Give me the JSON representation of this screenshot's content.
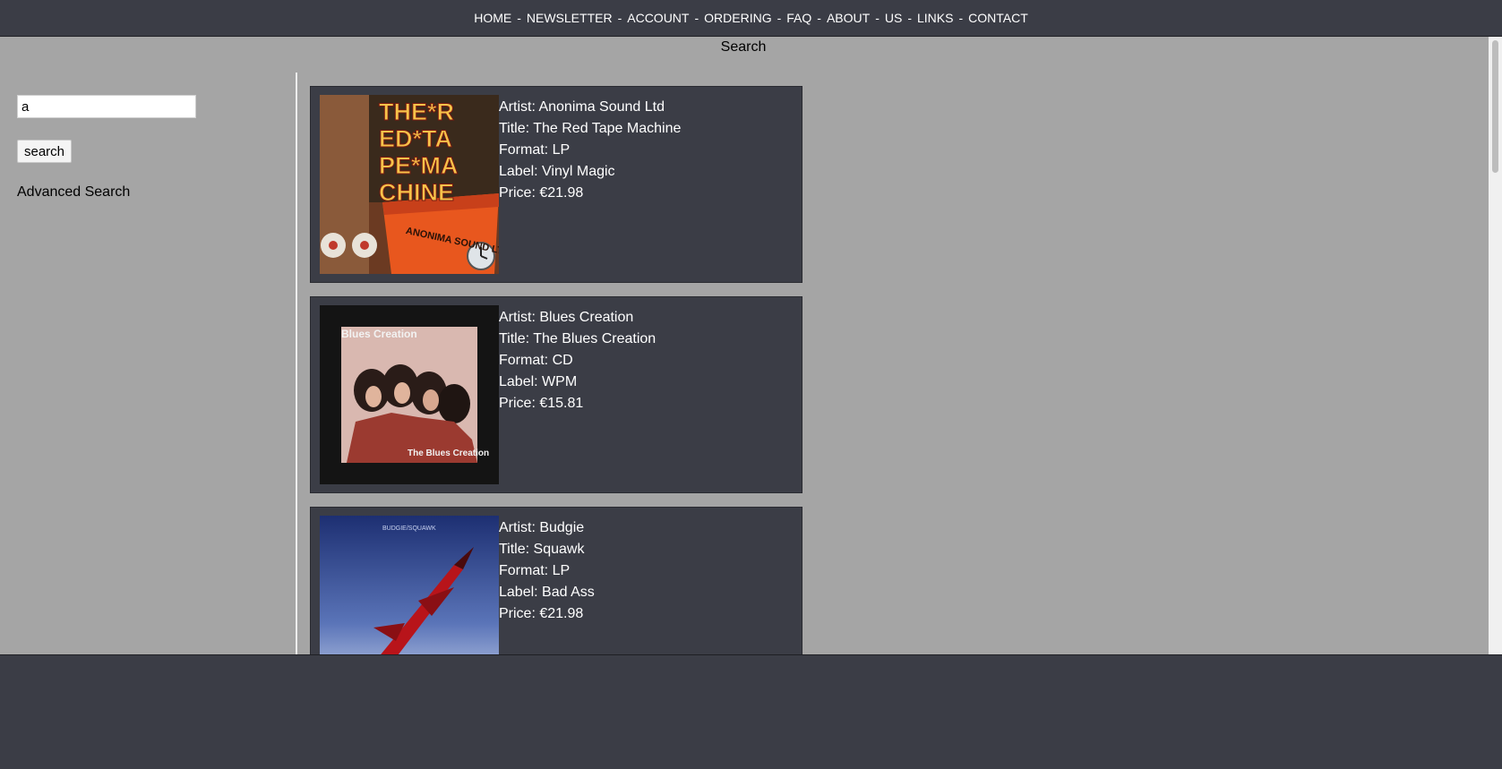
{
  "nav": {
    "items": [
      "HOME",
      "NEWSLETTER",
      "ACCOUNT",
      "ORDERING",
      "FAQ",
      "ABOUT",
      "US",
      "LINKS",
      "CONTACT"
    ],
    "separator": "-"
  },
  "page": {
    "heading": "Search"
  },
  "sidebar": {
    "search_value": "a",
    "search_button": "search",
    "advanced_link": "Advanced Search"
  },
  "results": [
    {
      "artist": "Artist: Anonima Sound Ltd",
      "title": "Title: The Red Tape Machine",
      "format": "Format: LP",
      "label": "Label: Vinyl Magic",
      "price": "Price: €21.98",
      "cover_text": [
        "THE*R",
        "ED*TA",
        "PE*MA",
        "CHINE"
      ],
      "cover_banner": "ANONIMA SOUND LTD."
    },
    {
      "artist": "Artist: Blues Creation",
      "title": "Title: The Blues Creation",
      "format": "Format: CD",
      "label": "Label: WPM",
      "price": "Price: €15.81",
      "cover_top": "Blues Creation",
      "cover_bottom": "The Blues Creation"
    },
    {
      "artist": "Artist: Budgie",
      "title": "Title: Squawk",
      "format": "Format: LP",
      "label": "Label: Bad Ass",
      "price": "Price: €21.98",
      "cover_top": "BUDGIE/SQUAWK"
    }
  ],
  "colors": {
    "nav_bg": "#3b3d46",
    "page_bg": "#a5a5a5",
    "card_bg": "#3b3d46",
    "text_light": "#ffffff"
  }
}
